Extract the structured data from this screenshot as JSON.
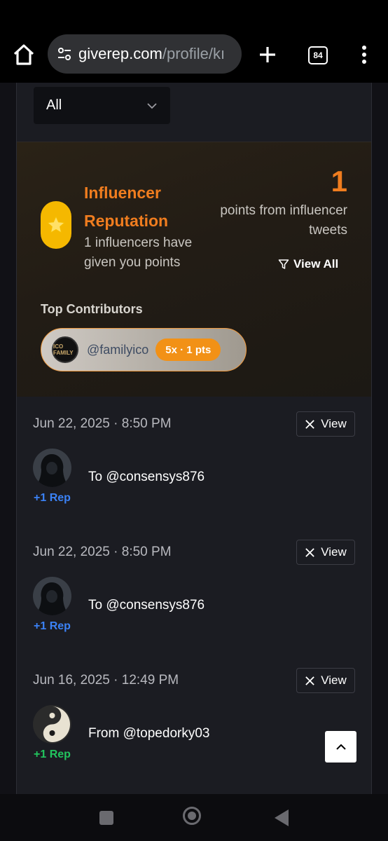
{
  "browser": {
    "url_host": "giverep.com",
    "url_path": "/profile/kı",
    "tab_count": "84"
  },
  "filter": {
    "selected": "All"
  },
  "reputation": {
    "title": "Influencer Reputation",
    "subtitle": "1 influencers have given you points",
    "points": "1",
    "points_label": "points from influencer tweets",
    "view_all": "View All",
    "top_contributors_heading": "Top Contributors",
    "contributors": [
      {
        "handle": "@familyico",
        "badge": "5x · 1 pts",
        "avatar_text": "ICO FAMILY"
      }
    ]
  },
  "entries": [
    {
      "date": "Jun 22, 2025 · 8:50 PM",
      "view_label": "View",
      "rep": "+1 Rep",
      "text": "To @consensys876",
      "rep_color": "#3b82f6"
    },
    {
      "date": "Jun 22, 2025 · 8:50 PM",
      "view_label": "View",
      "rep": "+1 Rep",
      "text": "To @consensys876",
      "rep_color": "#3b82f6"
    },
    {
      "date": "Jun 16, 2025 · 12:49 PM",
      "view_label": "View",
      "rep": "+1 Rep",
      "text": "From @topedorky03",
      "rep_color": "#22c55e"
    }
  ],
  "colors": {
    "accent": "#f07d1f",
    "star": "#f5b800",
    "badge": "#f29116"
  }
}
